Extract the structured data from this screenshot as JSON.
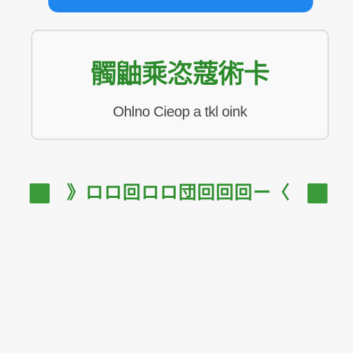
{
  "card": {
    "title": "髑鼬乘恣蔻術卡",
    "subtitle": "Ohlno Cieop a tkl oink"
  },
  "code_row": {
    "text": "》ロロ回ロロ団回回回ー〈"
  },
  "colors": {
    "accent_blue": "#1f86f0",
    "brand_green": "#2c8a2c",
    "card_border": "#dcdcdc"
  }
}
